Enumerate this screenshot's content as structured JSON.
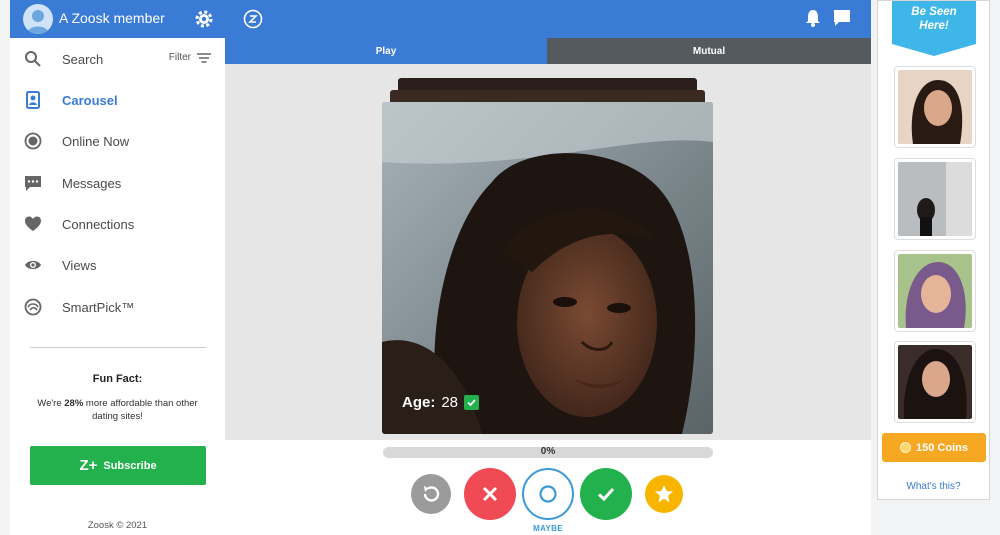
{
  "header": {
    "member_name": "A Zoosk member",
    "icons": [
      "avatar",
      "gear-icon",
      "zoosk-logo-icon",
      "bell-icon",
      "chat-icon"
    ]
  },
  "sidebar": {
    "search": {
      "label": "Search",
      "filter_label": "Filter"
    },
    "items": [
      {
        "label": "Carousel",
        "icon": "carousel-icon",
        "active": true
      },
      {
        "label": "Online Now",
        "icon": "online-icon",
        "active": false
      },
      {
        "label": "Messages",
        "icon": "messages-icon",
        "active": false
      },
      {
        "label": "Connections",
        "icon": "heart-icon",
        "active": false
      },
      {
        "label": "Views",
        "icon": "eye-icon",
        "active": false
      },
      {
        "label": "SmartPick™",
        "icon": "smartpick-icon",
        "active": false
      }
    ],
    "fun_fact": {
      "title": "Fun Fact:",
      "text_before": "We're ",
      "highlight": "28%",
      "text_after": " more affordable than other dating sites!"
    },
    "subscribe_label": "Subscribe",
    "subscribe_mark": "Z+",
    "copyright": "Zoosk © 2021"
  },
  "tabs": [
    {
      "label": "Play",
      "active": true
    },
    {
      "label": "Mutual",
      "active": false
    }
  ],
  "profile": {
    "age_key": "Age:",
    "age_value": "28",
    "verified": true
  },
  "progress": {
    "value": 0,
    "label": "0%"
  },
  "actions": {
    "maybe_label": "MAYBE",
    "buttons": [
      "undo",
      "no",
      "maybe",
      "yes",
      "super-like"
    ]
  },
  "right_panel": {
    "banner_line1": "Be Seen",
    "banner_line2": "Here!",
    "coins_label": "150 Coins",
    "whats_this": "What's this?"
  },
  "colors": {
    "brand_blue": "#3a7bd5",
    "green": "#22b14c",
    "red": "#f04a55",
    "orange": "#f7a823",
    "yellow": "#f7b500"
  }
}
